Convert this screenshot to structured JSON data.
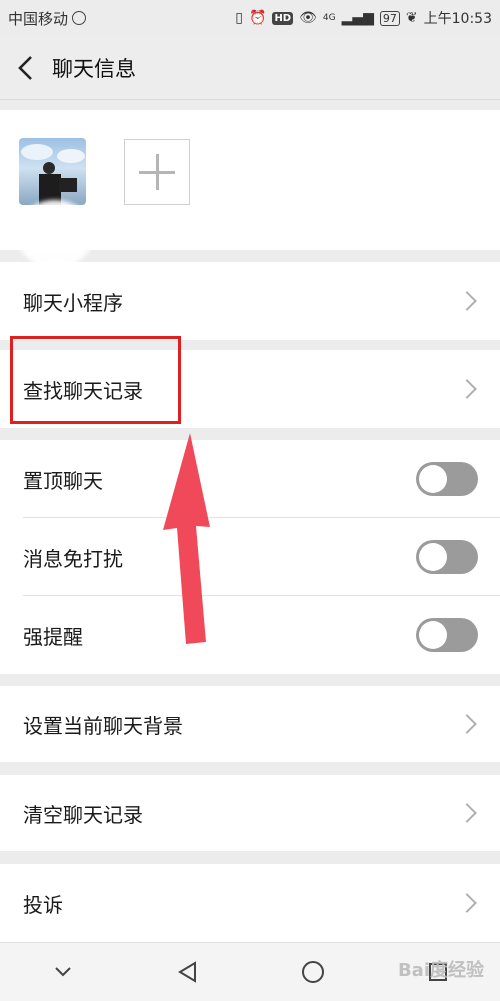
{
  "status_bar": {
    "carrier": "中国移动",
    "battery": "97",
    "time": "上午10:53",
    "hd": "HD",
    "net": "4G"
  },
  "header": {
    "title": "聊天信息"
  },
  "rows": {
    "mini_program": "聊天小程序",
    "search_history": "查找聊天记录",
    "pin_chat": "置顶聊天",
    "mute": "消息免打扰",
    "strong_reminder": "强提醒",
    "set_background": "设置当前聊天背景",
    "clear_history": "清空聊天记录",
    "complain": "投诉"
  },
  "toggles": {
    "pin_chat": false,
    "mute": false,
    "strong_reminder": false
  },
  "watermark": "Bai度经验",
  "colors": {
    "highlight": "#e02020",
    "arrow": "#f04a5a",
    "toggle_off": "#9b9b9b"
  }
}
